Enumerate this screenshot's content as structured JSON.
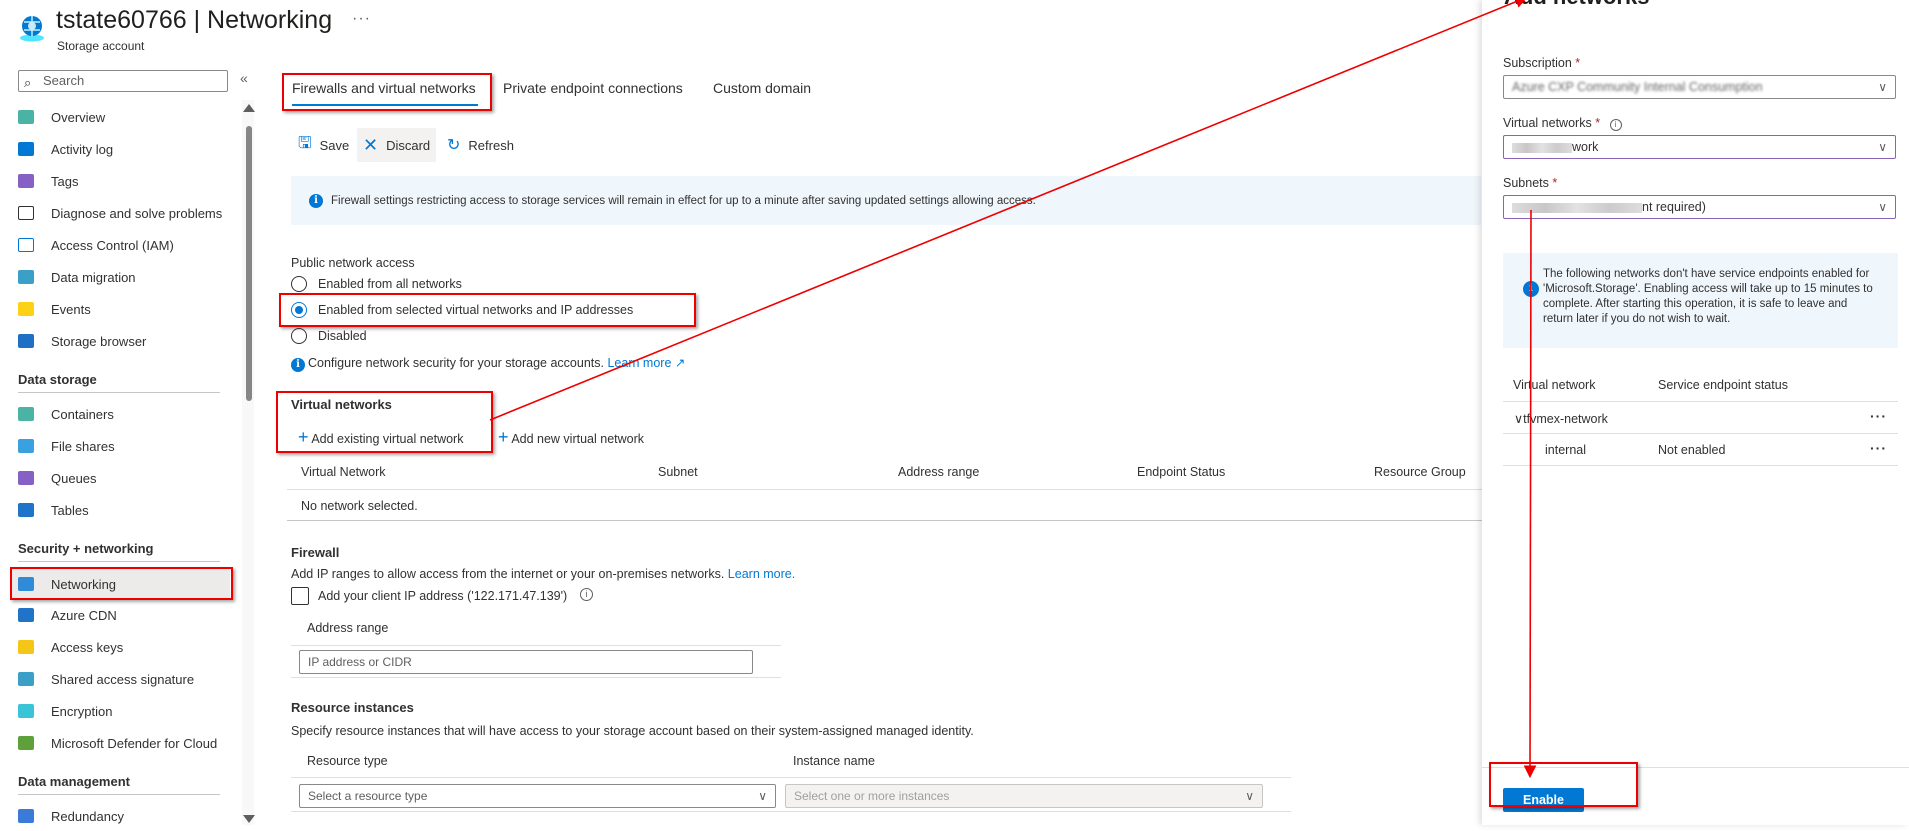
{
  "header": {
    "title": "tstate60766 | Networking",
    "subtitle": "Storage account",
    "more_label": "···"
  },
  "sidebar": {
    "search_placeholder": "Search",
    "collapse_label": "«",
    "items": [
      {
        "label": "Overview",
        "icon": "overview-icon"
      },
      {
        "label": "Activity log",
        "icon": "activity-log-icon"
      },
      {
        "label": "Tags",
        "icon": "tag-icon"
      },
      {
        "label": "Diagnose and solve problems",
        "icon": "wrench-icon"
      },
      {
        "label": "Access Control (IAM)",
        "icon": "people-icon"
      },
      {
        "label": "Data migration",
        "icon": "data-migration-icon"
      },
      {
        "label": "Events",
        "icon": "lightning-icon"
      },
      {
        "label": "Storage browser",
        "icon": "storage-browser-icon"
      }
    ],
    "sections": [
      {
        "title": "Data storage",
        "items": [
          {
            "label": "Containers",
            "icon": "containers-icon"
          },
          {
            "label": "File shares",
            "icon": "file-shares-icon"
          },
          {
            "label": "Queues",
            "icon": "queues-icon"
          },
          {
            "label": "Tables",
            "icon": "tables-icon"
          }
        ]
      },
      {
        "title": "Security + networking",
        "items": [
          {
            "label": "Networking",
            "icon": "networking-icon",
            "active": true
          },
          {
            "label": "Azure CDN",
            "icon": "cloud-icon"
          },
          {
            "label": "Access keys",
            "icon": "key-icon"
          },
          {
            "label": "Shared access signature",
            "icon": "link-icon"
          },
          {
            "label": "Encryption",
            "icon": "lock-icon"
          },
          {
            "label": "Microsoft Defender for Cloud",
            "icon": "shield-icon"
          }
        ]
      },
      {
        "title": "Data management",
        "items": [
          {
            "label": "Redundancy",
            "icon": "globe-icon"
          }
        ]
      }
    ]
  },
  "tabs": [
    {
      "label": "Firewalls and virtual networks",
      "active": true
    },
    {
      "label": "Private endpoint connections"
    },
    {
      "label": "Custom domain"
    }
  ],
  "toolbar": {
    "save_label": "Save",
    "discard_label": "Discard",
    "refresh_label": "Refresh"
  },
  "info_banner": "Firewall settings restricting access to storage services will remain in effect for up to a minute after saving updated settings allowing access.",
  "public_access": {
    "label": "Public network access",
    "options": [
      {
        "label": "Enabled from all networks",
        "selected": false
      },
      {
        "label": "Enabled from selected virtual networks and IP addresses",
        "selected": true
      },
      {
        "label": "Disabled",
        "selected": false
      }
    ],
    "hint": "Configure network security for your storage accounts.",
    "learn_more": "Learn more"
  },
  "virtual_networks": {
    "title": "Virtual networks",
    "add_existing": "Add existing virtual network",
    "add_new": "Add new virtual network",
    "columns": [
      "Virtual Network",
      "Subnet",
      "Address range",
      "Endpoint Status",
      "Resource Group"
    ],
    "empty": "No network selected."
  },
  "firewall": {
    "title": "Firewall",
    "description": "Add IP ranges to allow access from the internet or your on-premises networks.",
    "learn_more": "Learn more.",
    "client_ip_label": "Add your client IP address ('122.171.47.139')",
    "client_ip_checked": false,
    "address_range_header": "Address range",
    "address_placeholder": "IP address or CIDR"
  },
  "resource_instances": {
    "title": "Resource instances",
    "description": "Specify resource instances that will have access to your storage account based on their system-assigned managed identity.",
    "resource_type_header": "Resource type",
    "instance_name_header": "Instance name",
    "resource_type_placeholder": "Select a resource type",
    "instance_placeholder": "Select one or more instances"
  },
  "add_networks_panel": {
    "title": "Add networks",
    "subscription_label": "Subscription",
    "subscription_value": "Azure CXP Community Internal Consumption",
    "vnet_label": "Virtual networks",
    "vnet_value_visible": "work",
    "subnets_label": "Subnets",
    "subnets_value_visible": "nt required)",
    "required_mark": "*",
    "info": "The following networks don't have service endpoints enabled for 'Microsoft.Storage'. Enabling access will take up to 15 minutes to complete. After starting this operation, it is safe to leave and return later if you do not wish to wait.",
    "columns": [
      "Virtual network",
      "Service endpoint status"
    ],
    "rows": [
      {
        "name": "tfvmex-network",
        "status": "",
        "expanded": true
      },
      {
        "name": "internal",
        "status": "Not enabled"
      }
    ],
    "enable_label": "Enable"
  },
  "colors": {
    "accent": "#0078d4",
    "annotation": "#e00000",
    "info_bg": "#eff6fc"
  }
}
